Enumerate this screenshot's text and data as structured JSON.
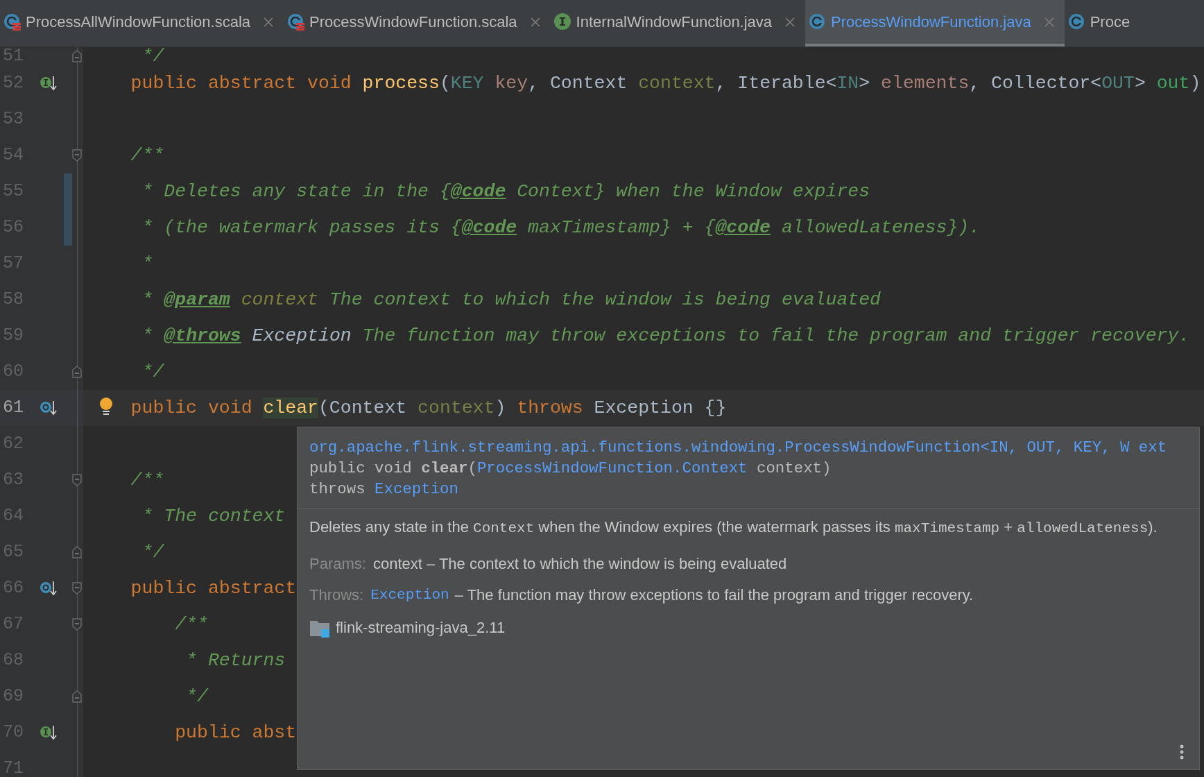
{
  "tabs": [
    {
      "label": "ProcessAllWindowFunction.scala",
      "kind": "scala",
      "selected": false
    },
    {
      "label": "ProcessWindowFunction.scala",
      "kind": "scala",
      "selected": false
    },
    {
      "label": "InternalWindowFunction.java",
      "kind": "interface",
      "selected": false
    },
    {
      "label": "ProcessWindowFunction.java",
      "kind": "class",
      "selected": true
    },
    {
      "label": "Proce",
      "kind": "class",
      "selected": false,
      "cut": true
    }
  ],
  "editor": {
    "lines": [
      {
        "number": "51",
        "fold_end": true,
        "tokens": [
          {
            "text": "     */",
            "kind": "comment"
          }
        ]
      },
      {
        "number": "52",
        "implements": true,
        "tokens": [
          {
            "text": "    public abstract void ",
            "kind": "keyword"
          },
          {
            "text": "process",
            "kind": "method"
          },
          {
            "text": "(",
            "kind": "plain"
          },
          {
            "text": "KEY",
            "kind": "typeparam"
          },
          {
            "text": " key",
            "kind": "param1"
          },
          {
            "text": ", Context ",
            "kind": "plain"
          },
          {
            "text": "context",
            "kind": "param2"
          },
          {
            "text": ", Iterable<",
            "kind": "plain"
          },
          {
            "text": "IN",
            "kind": "typeparam"
          },
          {
            "text": "> ",
            "kind": "plain"
          },
          {
            "text": "elements",
            "kind": "param1"
          },
          {
            "text": ", Collector<",
            "kind": "plain"
          },
          {
            "text": "OUT",
            "kind": "typeparam"
          },
          {
            "text": "> ",
            "kind": "plain"
          },
          {
            "text": "out",
            "kind": "param3"
          },
          {
            "text": ")",
            "kind": "plain"
          }
        ]
      },
      {
        "number": "53"
      },
      {
        "number": "54",
        "fold_start": true,
        "tokens": [
          {
            "text": "    /**",
            "kind": "comment"
          }
        ]
      },
      {
        "number": "55",
        "changed": true,
        "tokens": [
          {
            "text": "     * Deletes any state in the {",
            "kind": "comment"
          },
          {
            "text": "@code",
            "kind": "doctag"
          },
          {
            "text": " Context} when the Window expires",
            "kind": "comment"
          }
        ]
      },
      {
        "number": "56",
        "changed": true,
        "tokens": [
          {
            "text": "     * (the watermark passes its {",
            "kind": "comment"
          },
          {
            "text": "@code",
            "kind": "doctag"
          },
          {
            "text": " maxTimestamp} + {",
            "kind": "comment"
          },
          {
            "text": "@code",
            "kind": "doctag"
          },
          {
            "text": " allowedLateness}).",
            "kind": "comment"
          }
        ]
      },
      {
        "number": "57",
        "tokens": [
          {
            "text": "     *",
            "kind": "comment"
          }
        ]
      },
      {
        "number": "58",
        "tokens": [
          {
            "text": "     * ",
            "kind": "comment"
          },
          {
            "text": "@param",
            "kind": "doctag"
          },
          {
            "text": " context",
            "kind": "docparam"
          },
          {
            "text": " The context to which the window is being evaluated",
            "kind": "comment"
          }
        ]
      },
      {
        "number": "59",
        "tokens": [
          {
            "text": "     * ",
            "kind": "comment"
          },
          {
            "text": "@throws",
            "kind": "doctag"
          },
          {
            "text": " Exception",
            "kind": "docref"
          },
          {
            "text": " The function may throw exceptions to fail the program and trigger recovery.",
            "kind": "comment"
          }
        ]
      },
      {
        "number": "60",
        "fold_end": true,
        "tokens": [
          {
            "text": "     */",
            "kind": "comment"
          }
        ]
      },
      {
        "number": "61",
        "overrides": true,
        "bulb": true,
        "current": true,
        "tokens": [
          {
            "text": "    public void ",
            "kind": "keyword"
          },
          {
            "text": "clear",
            "kind": "methodhl"
          },
          {
            "text": "(Context ",
            "kind": "plain"
          },
          {
            "text": "context",
            "kind": "param2"
          },
          {
            "text": ") ",
            "kind": "plain"
          },
          {
            "text": "throws",
            "kind": "keyword"
          },
          {
            "text": " Exception {}",
            "kind": "plain"
          }
        ]
      },
      {
        "number": "62"
      },
      {
        "number": "63",
        "fold_start": true,
        "tokens": [
          {
            "text": "    /**",
            "kind": "comment"
          }
        ]
      },
      {
        "number": "64",
        "tokens": [
          {
            "text": "     * The context",
            "kind": "comment"
          }
        ]
      },
      {
        "number": "65",
        "fold_end": true,
        "tokens": [
          {
            "text": "     */",
            "kind": "comment"
          }
        ]
      },
      {
        "number": "66",
        "overrides": true,
        "fold_start": true,
        "tokens": [
          {
            "text": "    public abstract",
            "kind": "keyword"
          }
        ]
      },
      {
        "number": "67",
        "fold_start": true,
        "tokens": [
          {
            "text": "        /**",
            "kind": "comment"
          }
        ]
      },
      {
        "number": "68",
        "tokens": [
          {
            "text": "         * Returns",
            "kind": "comment"
          }
        ]
      },
      {
        "number": "69",
        "fold_end": true,
        "tokens": [
          {
            "text": "         */",
            "kind": "comment"
          }
        ]
      },
      {
        "number": "70",
        "implements": true,
        "tokens": [
          {
            "text": "        public abst",
            "kind": "keyword"
          }
        ]
      },
      {
        "number": "71"
      }
    ]
  },
  "popup": {
    "signature": [
      [
        {
          "text": "org.apache.flink.streaming.api.functions.windowing.ProcessWindowFunction<IN, OUT, KEY, W ext",
          "kind": "link"
        }
      ],
      [
        {
          "text": "public void ",
          "kind": "text"
        },
        {
          "text": "clear",
          "kind": "bold"
        },
        {
          "text": "(",
          "kind": "text"
        },
        {
          "text": "ProcessWindowFunction.Context",
          "kind": "link"
        },
        {
          "text": " context)",
          "kind": "text"
        }
      ],
      [
        {
          "text": "throws ",
          "kind": "text"
        },
        {
          "text": "Exception",
          "kind": "link"
        }
      ]
    ],
    "description": [
      {
        "text": "Deletes any state in the ",
        "kind": "text"
      },
      {
        "text": "Context",
        "kind": "code"
      },
      {
        "text": " when the Window expires (the watermark passes its ",
        "kind": "text"
      },
      {
        "text": "maxTimestamp",
        "kind": "code"
      },
      {
        "text": " + ",
        "kind": "text"
      },
      {
        "text": "allowedLateness",
        "kind": "code"
      },
      {
        "text": ").",
        "kind": "text"
      }
    ],
    "sections": [
      {
        "label": "Params:",
        "text": "context – The context to which the window is being evaluated"
      },
      {
        "label": "Throws:",
        "link": "Exception",
        "text": "– The function may throw exceptions to fail the program and trigger recovery."
      }
    ],
    "module": "flink-streaming-java_2.11"
  }
}
